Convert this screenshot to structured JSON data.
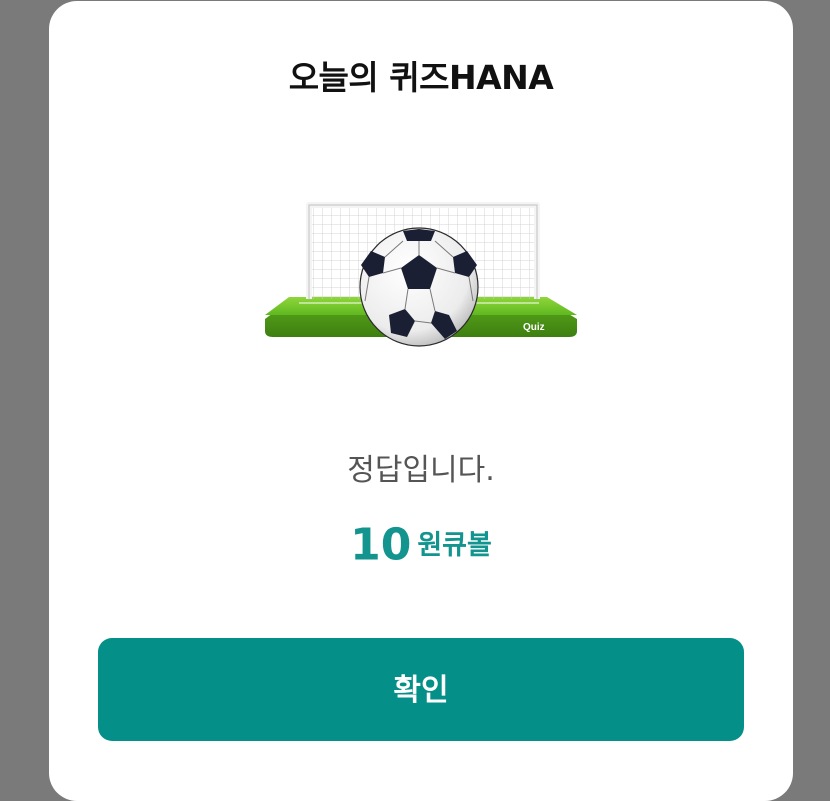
{
  "dialog": {
    "title": "오늘의 퀴즈HANA",
    "illustration_tag": "Quiz",
    "result_text": "정답입니다.",
    "reward_amount": "10",
    "reward_unit": "원큐볼",
    "confirm_label": "확인"
  },
  "colors": {
    "accent": "#048f88",
    "reward": "#13948e",
    "backdrop": "#7a7a7a",
    "field_green": "#6cc42a"
  },
  "icons": {
    "illustration": "soccer-goal-quiz-illustration"
  }
}
